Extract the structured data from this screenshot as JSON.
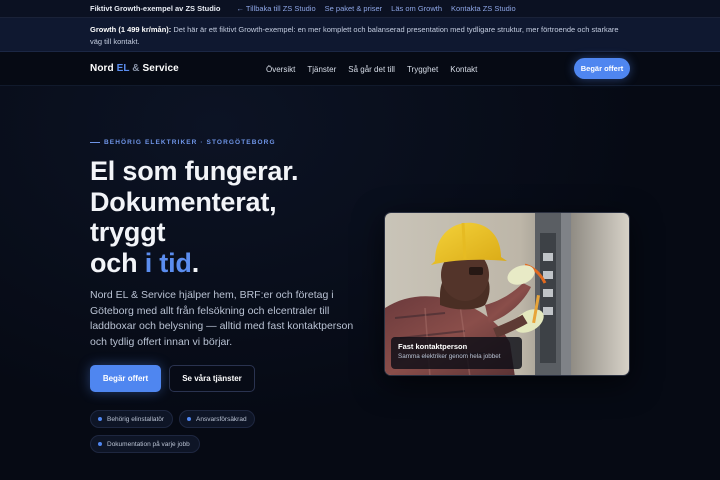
{
  "demo_bar": {
    "title": "Fiktivt Growth-exempel av ZS Studio",
    "links": [
      "← Tillbaka till ZS Studio",
      "Se paket & priser",
      "Läs om Growth",
      "Kontakta ZS Studio"
    ]
  },
  "growth_bar": {
    "label": "Growth (1 499 kr/mån):",
    "text": " Det här är ett fiktivt Growth-exempel: en mer komplett och balanserad presentation med tydligare struktur, mer förtroende och starkare väg till kontakt."
  },
  "nav": {
    "logo_part1": "Nord ",
    "logo_accent": "EL",
    "logo_amp": " & ",
    "logo_part2": "Service",
    "links": [
      "Översikt",
      "Tjänster",
      "Så går det till",
      "Trygghet",
      "Kontakt"
    ],
    "cta_label": "Begär offert"
  },
  "hero": {
    "eyebrow": "BEHÖRIG ELEKTRIKER · STORGÖTEBORG",
    "headline_line1": "El som fungerar.",
    "headline_line2": "Dokumenterat,",
    "headline_line3": "tryggt",
    "headline_line4_start": "och ",
    "headline_line4_accent": "i tid",
    "headline_line4_end": ".",
    "lead": "Nord EL & Service hjälper hem, BRF:er och företag i Göteborg med allt från felsökning och elcentraler till laddboxar och belysning — alltid med fast kontaktperson och tydlig offert innan vi börjar.",
    "primary_button": "Begär offert",
    "secondary_button": "Se våra tjänster",
    "badges": [
      "Behörig elinstallatör",
      "Ansvarsförsäkrad",
      "Dokumentation på varje jobb"
    ]
  },
  "photo_card": {
    "caption_title": "Fast kontaktperson",
    "caption_subtitle": "Samma elektriker genom hela jobbet"
  },
  "colors": {
    "accent": "#4f86f0",
    "background": "#060a14"
  }
}
